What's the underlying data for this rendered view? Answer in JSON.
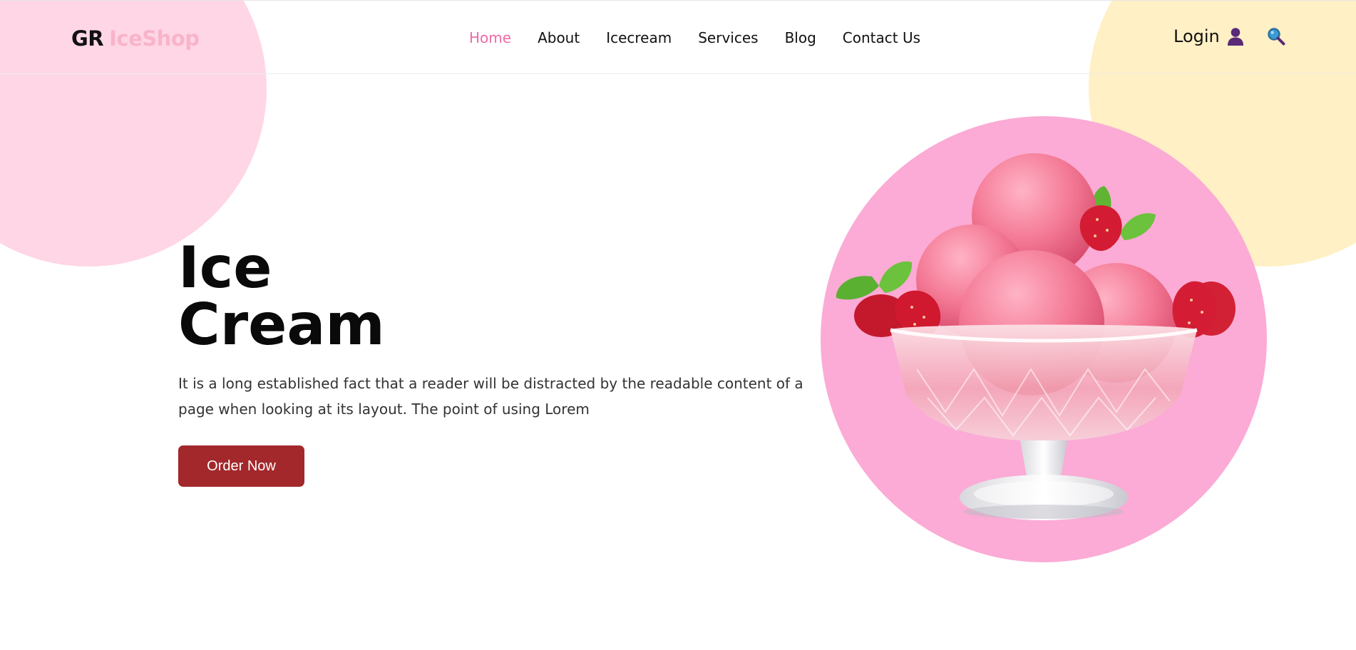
{
  "colors": {
    "accent_pink": "#f06aa6",
    "brand_pink": "#f9b4c9",
    "blob_pink": "#ffd6e6",
    "blob_yellow": "#fff0c5",
    "hero_circle": "#fbabd5",
    "button": "#a2282b",
    "icon_purple": "#5a2a78",
    "icon_blue": "#3a9bd5"
  },
  "header": {
    "brand": {
      "part1": "GR",
      "part2": "IceShop"
    },
    "nav": [
      {
        "label": "Home",
        "active": true
      },
      {
        "label": "About",
        "active": false
      },
      {
        "label": "Icecream",
        "active": false
      },
      {
        "label": "Services",
        "active": false
      },
      {
        "label": "Blog",
        "active": false
      },
      {
        "label": "Contact Us",
        "active": false
      }
    ],
    "login_label": "Login",
    "icons": [
      "user-icon",
      "search-icon"
    ]
  },
  "hero": {
    "title_line1": "Ice",
    "title_line2": "Cream",
    "description": "It is a long established fact that a reader will be distracted by the readable content of a page when looking at its layout. The point of using Lorem",
    "button_label": "Order Now",
    "image_subject": "strawberry-ice-cream-bowl"
  }
}
